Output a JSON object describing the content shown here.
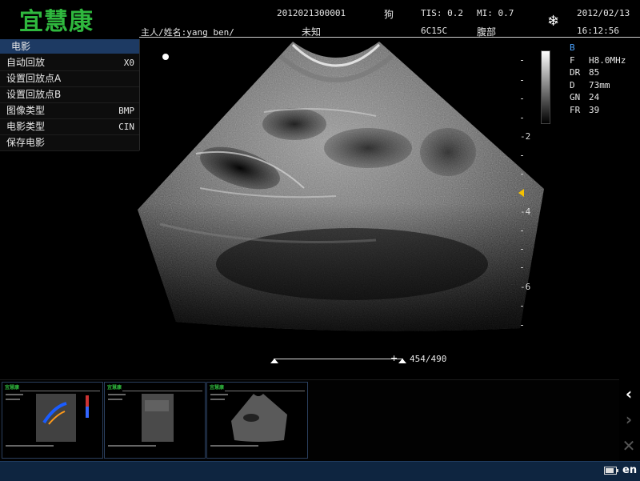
{
  "header": {
    "logo": "宜慧康",
    "owner_label": "主人/姓名:yang ben/",
    "patient_id": "2012021300001",
    "species": "狗",
    "gender": "未知",
    "tis": "TIS: 0.2",
    "mi": "MI: 0.7",
    "probe": "6C15C",
    "exam": "腹部",
    "date": "2012/02/13",
    "time": "16:12:56",
    "freeze_icon": "snowflake-icon"
  },
  "cine_menu": {
    "title": "电影",
    "items": [
      {
        "label": "自动回放",
        "value": "X0"
      },
      {
        "label": "设置回放点A",
        "value": ""
      },
      {
        "label": "设置回放点B",
        "value": ""
      },
      {
        "label": "图像类型",
        "value": "BMP"
      },
      {
        "label": "电影类型",
        "value": "CIN"
      },
      {
        "label": "保存电影",
        "value": ""
      }
    ]
  },
  "depth_scale": {
    "labels": [
      "-2",
      "-4",
      "-6"
    ]
  },
  "params": {
    "mode": "B",
    "rows": [
      {
        "k": "F",
        "v": "H8.0MHz"
      },
      {
        "k": "DR",
        "v": "85"
      },
      {
        "k": "D",
        "v": "73mm"
      },
      {
        "k": "GN",
        "v": "24"
      },
      {
        "k": "FR",
        "v": "39"
      }
    ]
  },
  "cine": {
    "frame_count": "454/490",
    "position": 0.926
  },
  "thumbnails": [
    {
      "name": "doppler-clip"
    },
    {
      "name": "bmode-clip-1"
    },
    {
      "name": "bmode-clip-2"
    }
  ],
  "nav": {
    "prev": "‹",
    "next": "›",
    "close": "✕"
  },
  "status": {
    "language": "en",
    "battery_level": 0.8
  },
  "colors": {
    "logo": "#2fb83e",
    "menu_title_bg": "#1d3a63",
    "focus_marker": "#f5c100",
    "status_bg": "#0e2540"
  }
}
